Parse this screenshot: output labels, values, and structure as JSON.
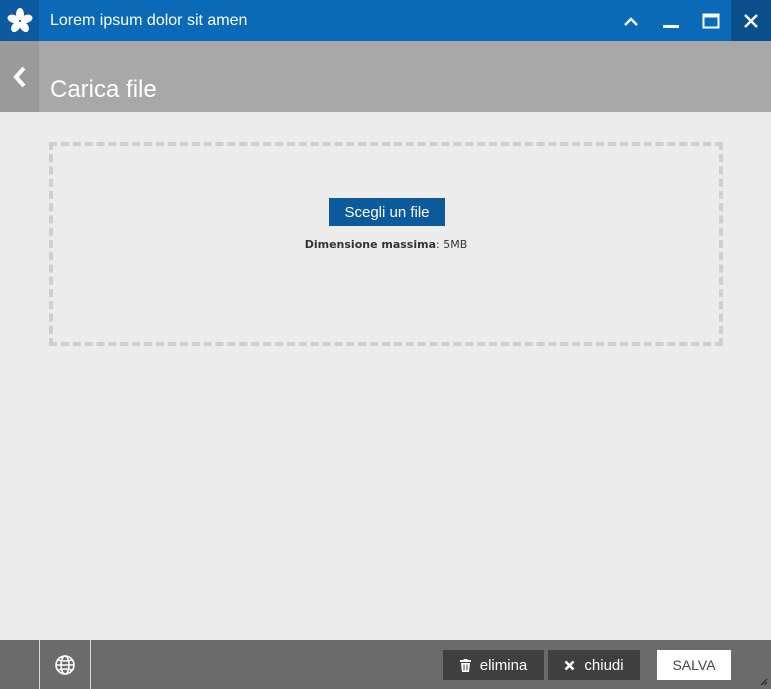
{
  "window": {
    "title": "Lorem ipsum dolor sit amen",
    "logo_icon": "asterisk-icon",
    "controls": [
      "chevron-up-icon",
      "minimize-icon",
      "maximize-icon",
      "close-icon"
    ]
  },
  "header": {
    "back_icon": "chevron-left-icon",
    "title": "Carica file"
  },
  "upload": {
    "choose_label": "Scegli un file",
    "max_size_label": "Dimensione massima",
    "max_size_value": ": 5MB"
  },
  "footer": {
    "globe_icon": "globe-icon",
    "delete_label": "elimina",
    "close_label": "chiudi",
    "save_label": "SALVA"
  },
  "colors": {
    "titlebar": "#0a6ab8",
    "header": "#a8a8a8",
    "footer": "#6b6b6b",
    "primary_button": "#0a5a9c"
  }
}
